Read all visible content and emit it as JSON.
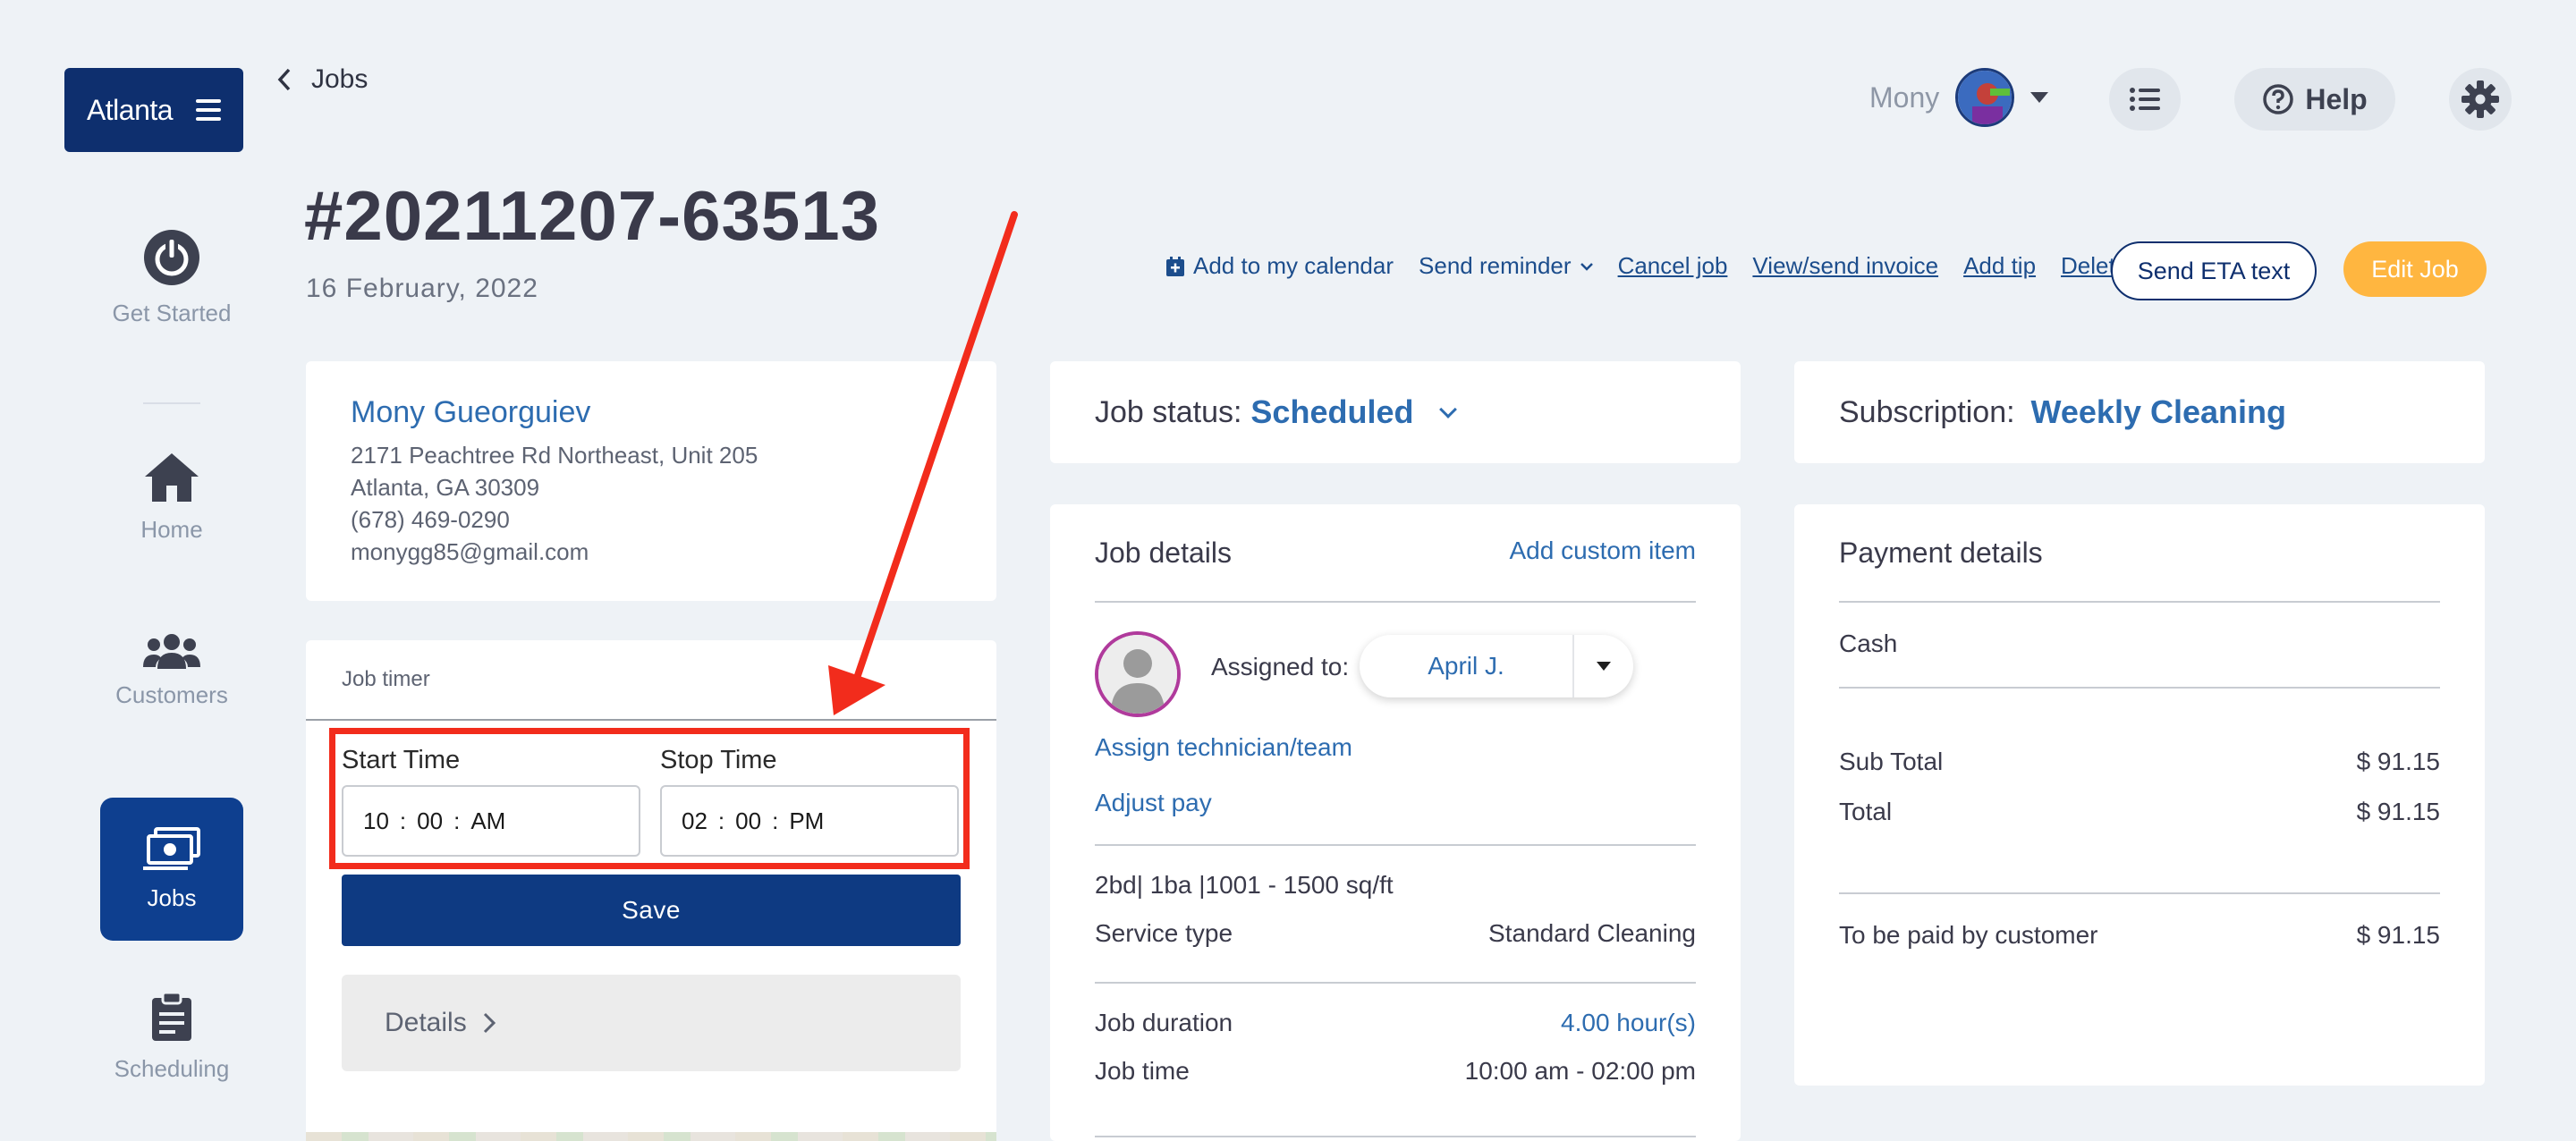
{
  "brand": {
    "name": "Atlanta"
  },
  "sidebar": {
    "items": [
      {
        "label": "Get Started",
        "icon": "power-icon"
      },
      {
        "label": "Home",
        "icon": "home-icon"
      },
      {
        "label": "Customers",
        "icon": "users-icon"
      },
      {
        "label": "Jobs",
        "icon": "money-icon",
        "active": true
      },
      {
        "label": "Scheduling",
        "icon": "clipboard-icon"
      }
    ]
  },
  "topbar": {
    "back_label": "Jobs",
    "user_name": "Mony",
    "help_label": "Help"
  },
  "job": {
    "number": "#20211207-63513",
    "date": "16 February, 2022"
  },
  "actions": {
    "add_calendar": "Add to my calendar",
    "send_reminder": "Send reminder",
    "cancel_job": "Cancel job",
    "view_invoice": "View/send invoice",
    "add_tip": "Add tip",
    "delete_job": "Delete job",
    "send_eta": "Send ETA text",
    "edit_job": "Edit Job"
  },
  "customer": {
    "name": "Mony Gueorguiev",
    "address1": "2171 Peachtree Rd Northeast, Unit 205",
    "address2": "Atlanta, GA 30309",
    "phone": "(678) 469-0290",
    "email": "monygg85@gmail.com"
  },
  "timer": {
    "title": "Job timer",
    "start_label": "Start Time",
    "start_value": {
      "h": "10",
      "m": "00",
      "ampm": "AM"
    },
    "stop_label": "Stop Time",
    "stop_value": {
      "h": "02",
      "m": "00",
      "ampm": "PM"
    },
    "save_label": "Save",
    "details_label": "Details"
  },
  "status": {
    "label": "Job status:",
    "value": "Scheduled"
  },
  "job_details": {
    "title": "Job details",
    "add_custom": "Add custom item",
    "assigned_label": "Assigned to:",
    "assigned_name": "April J.",
    "assign_link": "Assign technician/team",
    "adjust_pay": "Adjust pay",
    "rooms": "2bd| 1ba |1001 - 1500 sq/ft",
    "service_type_label": "Service type",
    "service_type_value": "Standard Cleaning",
    "duration_label": "Job duration",
    "duration_value": "4.00 hour(s)",
    "time_label": "Job time",
    "time_value": "10:00 am - 02:00 pm"
  },
  "subscription": {
    "label": "Subscription:",
    "value": "Weekly Cleaning"
  },
  "payment": {
    "title": "Payment details",
    "method": "Cash",
    "subtotal_label": "Sub Total",
    "subtotal_value": "$ 91.15",
    "total_label": "Total",
    "total_value": "$ 91.15",
    "due_label": "To be paid by customer",
    "due_value": "$ 91.15"
  },
  "colors": {
    "brand_navy": "#0e2f6e",
    "accent_blue": "#2d6cb0",
    "edit_orange": "#ffb640",
    "annotation_red": "#f22c1c"
  }
}
